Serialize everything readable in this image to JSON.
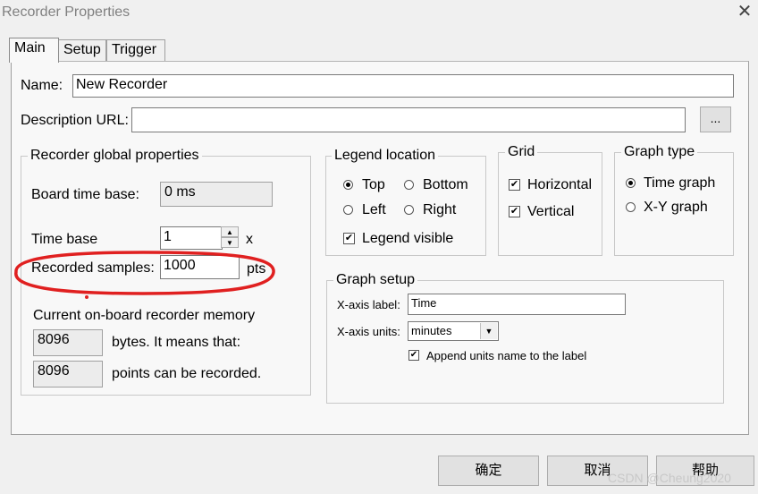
{
  "window": {
    "title": "Recorder Properties",
    "close_glyph": "✕"
  },
  "tabs": [
    {
      "label": "Main",
      "active": true
    },
    {
      "label": "Setup",
      "active": false
    },
    {
      "label": "Trigger",
      "active": false
    }
  ],
  "main": {
    "name_label": "Name:",
    "name_value": "New Recorder",
    "description_label": "Description URL:",
    "description_value": "",
    "browse_label": "...",
    "recorder_global": {
      "legend": "Recorder global properties",
      "board_time_base_label": "Board time base:",
      "board_time_base_value": "0 ms",
      "time_base_label": "Time base",
      "time_base_value": "1",
      "time_base_unit": "x",
      "recorded_samples_label": "Recorded samples:",
      "recorded_samples_value": "1000",
      "recorded_samples_unit": "pts",
      "memory_title": "Current on-board recorder memory",
      "bytes_value": "8096",
      "bytes_text": "bytes. It means that:",
      "points_value": "8096",
      "points_text": "points can be recorded."
    },
    "legend_location": {
      "legend": "Legend location",
      "options": [
        "Top",
        "Bottom",
        "Left",
        "Right"
      ],
      "selected": "Top",
      "visible_label": "Legend visible",
      "visible_checked": true
    },
    "grid": {
      "legend": "Grid",
      "horizontal_label": "Horizontal",
      "horizontal_checked": true,
      "vertical_label": "Vertical",
      "vertical_checked": true
    },
    "graph_type": {
      "legend": "Graph type",
      "options": [
        "Time graph",
        "X-Y graph"
      ],
      "selected": "Time graph"
    },
    "graph_setup": {
      "legend": "Graph setup",
      "xaxis_label_label": "X-axis label:",
      "xaxis_label_value": "Time",
      "xaxis_units_label": "X-axis units:",
      "xaxis_units_value": "minutes",
      "append_label": "Append units name to the label",
      "append_checked": true
    }
  },
  "footer": {
    "ok_label": "确定",
    "cancel_label": "取消",
    "help_label": "帮助"
  },
  "watermark": "CSDN @Cheung2020",
  "check_glyph": "✔",
  "spin_up_glyph": "▲",
  "spin_down_glyph": "▼",
  "dropdown_glyph": "▼",
  "annotation_color": "#e02020"
}
